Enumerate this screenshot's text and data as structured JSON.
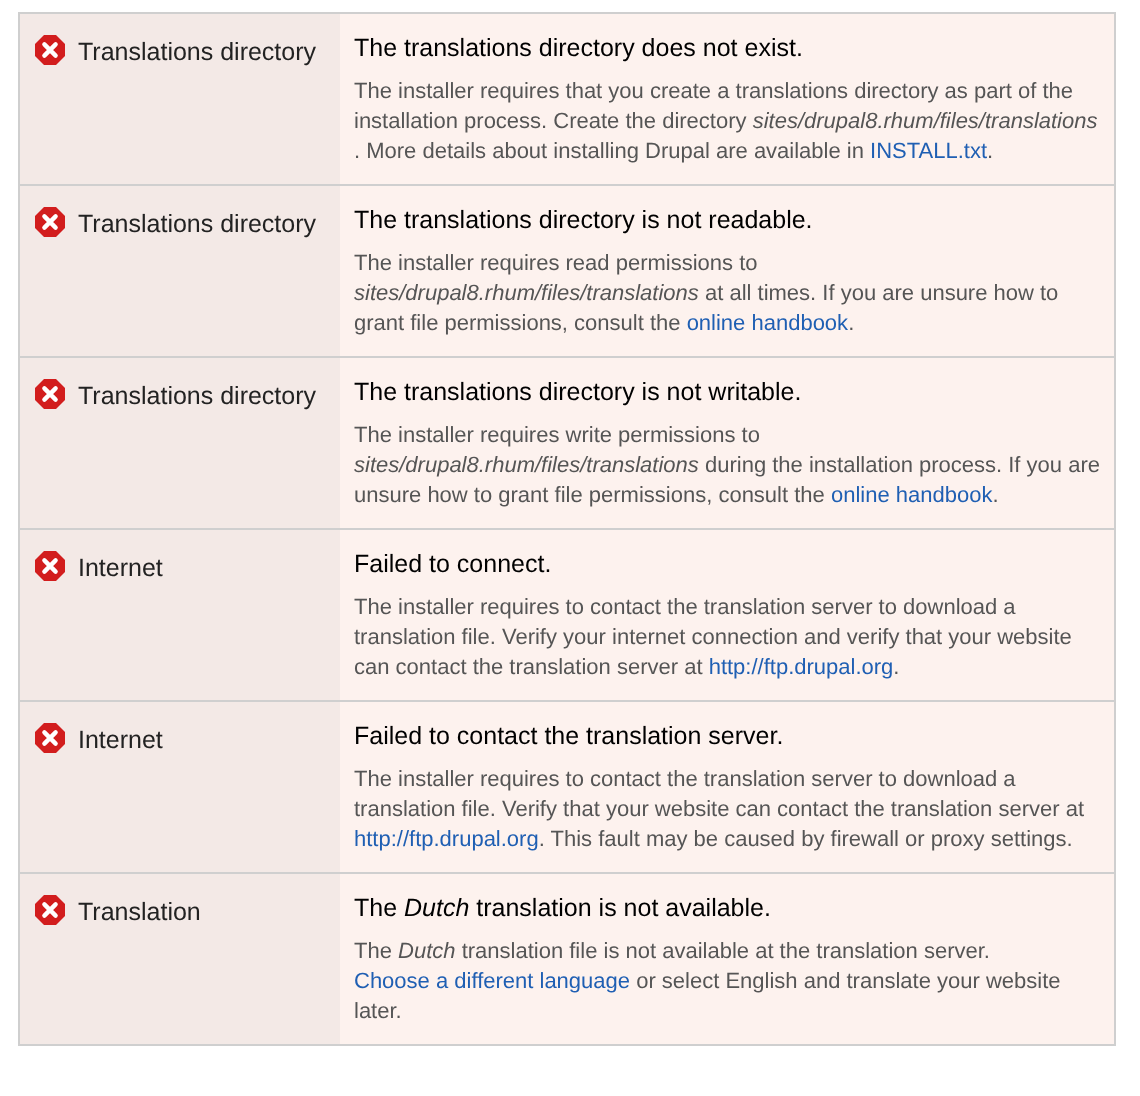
{
  "requirements": [
    {
      "label": "Translations directory",
      "title": "The translations directory does not exist.",
      "description": [
        {
          "kind": "text",
          "text": "The installer requires that you create a translations directory as part of the installation process. Create the directory "
        },
        {
          "kind": "em",
          "text": "sites/drupal8.rhum/files/translations"
        },
        {
          "kind": "text",
          "text": " . More details about installing Drupal are available in "
        },
        {
          "kind": "link",
          "text": "INSTALL.txt"
        },
        {
          "kind": "text",
          "text": "."
        }
      ]
    },
    {
      "label": "Translations directory",
      "title": "The translations directory is not readable.",
      "description": [
        {
          "kind": "text",
          "text": "The installer requires read permissions to "
        },
        {
          "kind": "em",
          "text": "sites/drupal8.rhum/files/translations"
        },
        {
          "kind": "text",
          "text": " at all times. If you are unsure how to grant file permissions, consult the "
        },
        {
          "kind": "link",
          "text": "online handbook"
        },
        {
          "kind": "text",
          "text": "."
        }
      ]
    },
    {
      "label": "Translations directory",
      "title": "The translations directory is not writable.",
      "description": [
        {
          "kind": "text",
          "text": "The installer requires write permissions to "
        },
        {
          "kind": "em",
          "text": "sites/drupal8.rhum/files/translations"
        },
        {
          "kind": "text",
          "text": " during the installation process. If you are unsure how to grant file permissions, consult the "
        },
        {
          "kind": "link",
          "text": "online handbook"
        },
        {
          "kind": "text",
          "text": "."
        }
      ]
    },
    {
      "label": "Internet",
      "title": "Failed to connect.",
      "description": [
        {
          "kind": "text",
          "text": "The installer requires to contact the translation server to download a translation file. Verify your internet connection and verify that your website can contact the translation server at "
        },
        {
          "kind": "link",
          "text": "http://ftp.drupal.org"
        },
        {
          "kind": "text",
          "text": "."
        }
      ]
    },
    {
      "label": "Internet",
      "title": "Failed to contact the translation server.",
      "description": [
        {
          "kind": "text",
          "text": "The installer requires to contact the translation server to download a translation file. Verify that your website can contact the translation server at "
        },
        {
          "kind": "link",
          "text": "http://ftp.drupal.org"
        },
        {
          "kind": "text",
          "text": ". This fault may be caused by firewall or proxy settings."
        }
      ]
    },
    {
      "label": "Translation",
      "title": "The *Dutch* translation is not available.",
      "description": [
        {
          "kind": "text",
          "text": "The "
        },
        {
          "kind": "em",
          "text": "Dutch"
        },
        {
          "kind": "text",
          "text": " translation file is not available at the translation server. "
        },
        {
          "kind": "link",
          "text": "Choose a different language"
        },
        {
          "kind": "text",
          "text": " or select English and translate your website later."
        }
      ]
    }
  ]
}
